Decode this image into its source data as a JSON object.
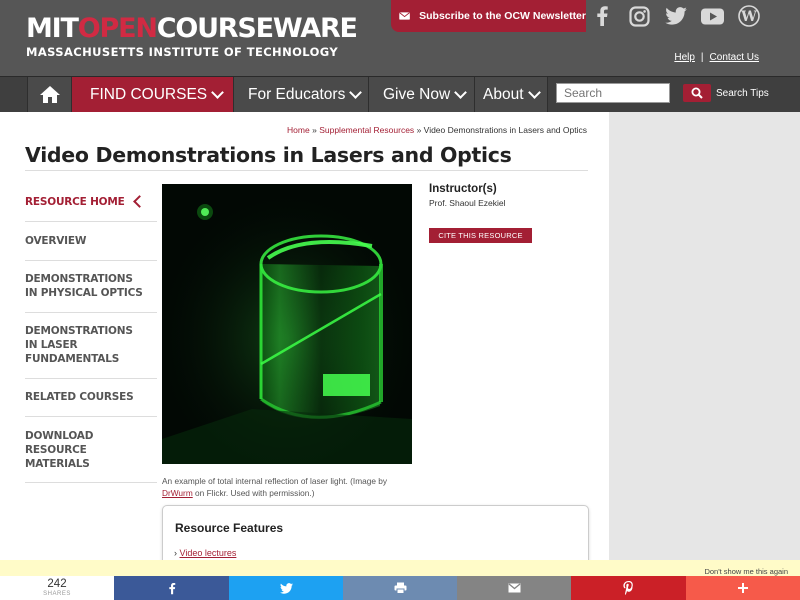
{
  "header": {
    "logo_part1": "MIT",
    "logo_part2": "OPEN",
    "logo_part3": "COURSEWARE",
    "logo_subtitle": "MASSACHUSETTS INSTITUTE OF TECHNOLOGY",
    "newsletter_label": "Subscribe to the OCW Newsletter",
    "social_icons": [
      "facebook-icon",
      "instagram-icon",
      "twitter-icon",
      "youtube-icon",
      "wordpress-icon"
    ],
    "help_label": "Help",
    "contact_label": "Contact Us"
  },
  "nav": {
    "items": [
      {
        "label": "FIND COURSES"
      },
      {
        "label": "For Educators"
      },
      {
        "label": "Give Now"
      },
      {
        "label": "About"
      }
    ],
    "search_placeholder": "Search",
    "search_tips": "Search Tips"
  },
  "breadcrumb": {
    "home": "Home",
    "sep": "»",
    "section": "Supplemental Resources",
    "current": "Video Demonstrations in Lasers and Optics"
  },
  "page": {
    "title": "Video Demonstrations in Lasers and Optics"
  },
  "sidebar": {
    "items": [
      {
        "label": "RESOURCE HOME"
      },
      {
        "label": "OVERVIEW"
      },
      {
        "label": "DEMONSTRATIONS\nIN PHYSICAL OPTICS"
      },
      {
        "label": "DEMONSTRATIONS\nIN LASER\nFUNDAMENTALS"
      },
      {
        "label": "RELATED COURSES"
      },
      {
        "label": "DOWNLOAD\nRESOURCE\nMATERIALS"
      }
    ]
  },
  "image": {
    "caption_pre": "An example of total internal reflection of laser light. (Image by",
    "caption_link": "DrWurm",
    "caption_post": "on Flickr. Used with permission.)"
  },
  "instructor": {
    "heading": "Instructor(s)",
    "name": "Prof. Shaoul Ezekiel",
    "cite_label": "CITE THIS RESOURCE"
  },
  "features": {
    "heading": "Resource Features",
    "item": "Video lectures"
  },
  "sharebar": {
    "count": "242",
    "count_label": "SHARES",
    "dont_show": "Don't show me this again",
    "buttons": [
      {
        "icon": "facebook-icon",
        "color": "#3b5998"
      },
      {
        "icon": "twitter-icon",
        "color": "#1da1f2"
      },
      {
        "icon": "print-icon",
        "color": "#6d8bb1"
      },
      {
        "icon": "email-icon",
        "color": "#848484"
      },
      {
        "icon": "pinterest-icon",
        "color": "#cb2027"
      },
      {
        "icon": "plus-icon",
        "color": "#f65a4a"
      }
    ]
  },
  "colors": {
    "brand_red": "#a31f34",
    "header_gray": "#565656",
    "laser_green": "#36ff3c"
  }
}
